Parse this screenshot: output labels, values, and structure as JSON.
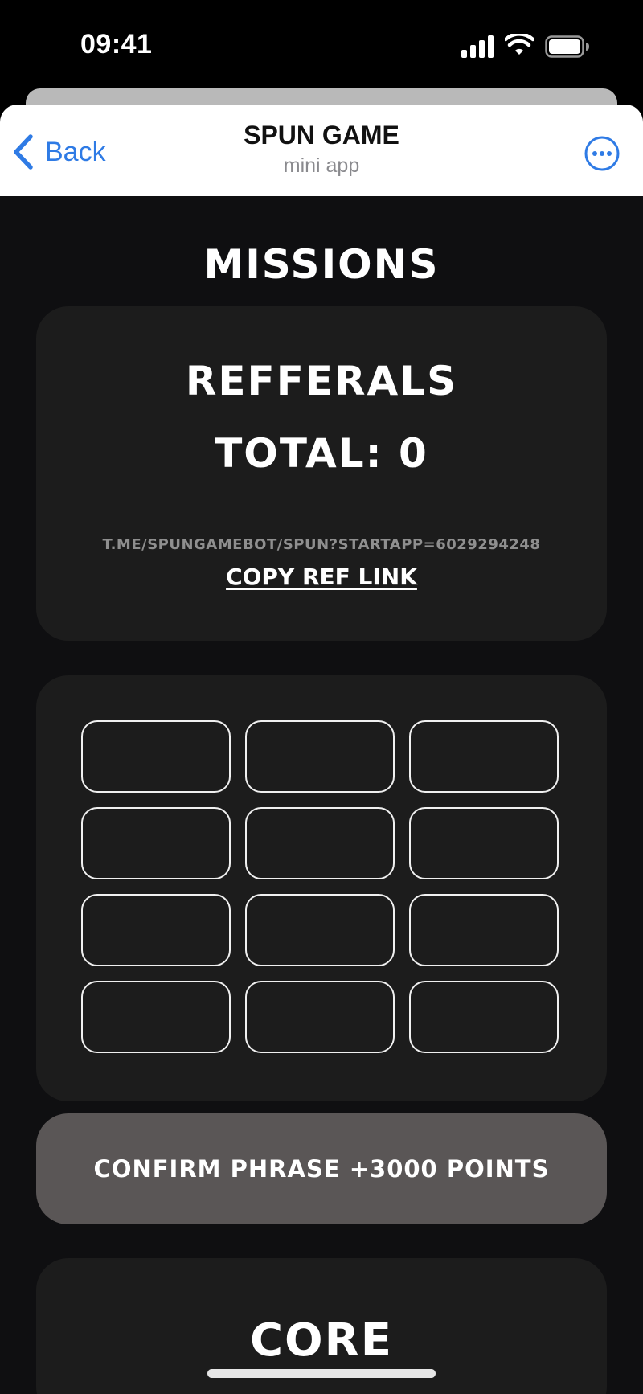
{
  "status_bar": {
    "time": "09:41"
  },
  "header": {
    "back_label": "Back",
    "title": "SPUN GAME",
    "subtitle": "mini app",
    "accent_color": "#2f7be5"
  },
  "page": {
    "title": "MISSIONS"
  },
  "referrals": {
    "title": "REFFERALS",
    "total": "TOTAL: 0",
    "link": "T.ME/SPUNGAMEBOT/SPUN?STARTAPP=6029294248",
    "copy_label": "COPY REF LINK"
  },
  "phrase": {
    "words": [
      "",
      "",
      "",
      "",
      "",
      "",
      "",
      "",
      "",
      "",
      "",
      ""
    ]
  },
  "confirm_button": {
    "label": "CONFIRM PHRASE +3000 POINTS"
  },
  "core": {
    "title": "CORE"
  },
  "icons": {
    "back": "chevron-left-icon",
    "more": "ellipsis-circle-icon",
    "signal": "cellular-signal-icon",
    "wifi": "wifi-icon",
    "battery": "battery-icon"
  }
}
